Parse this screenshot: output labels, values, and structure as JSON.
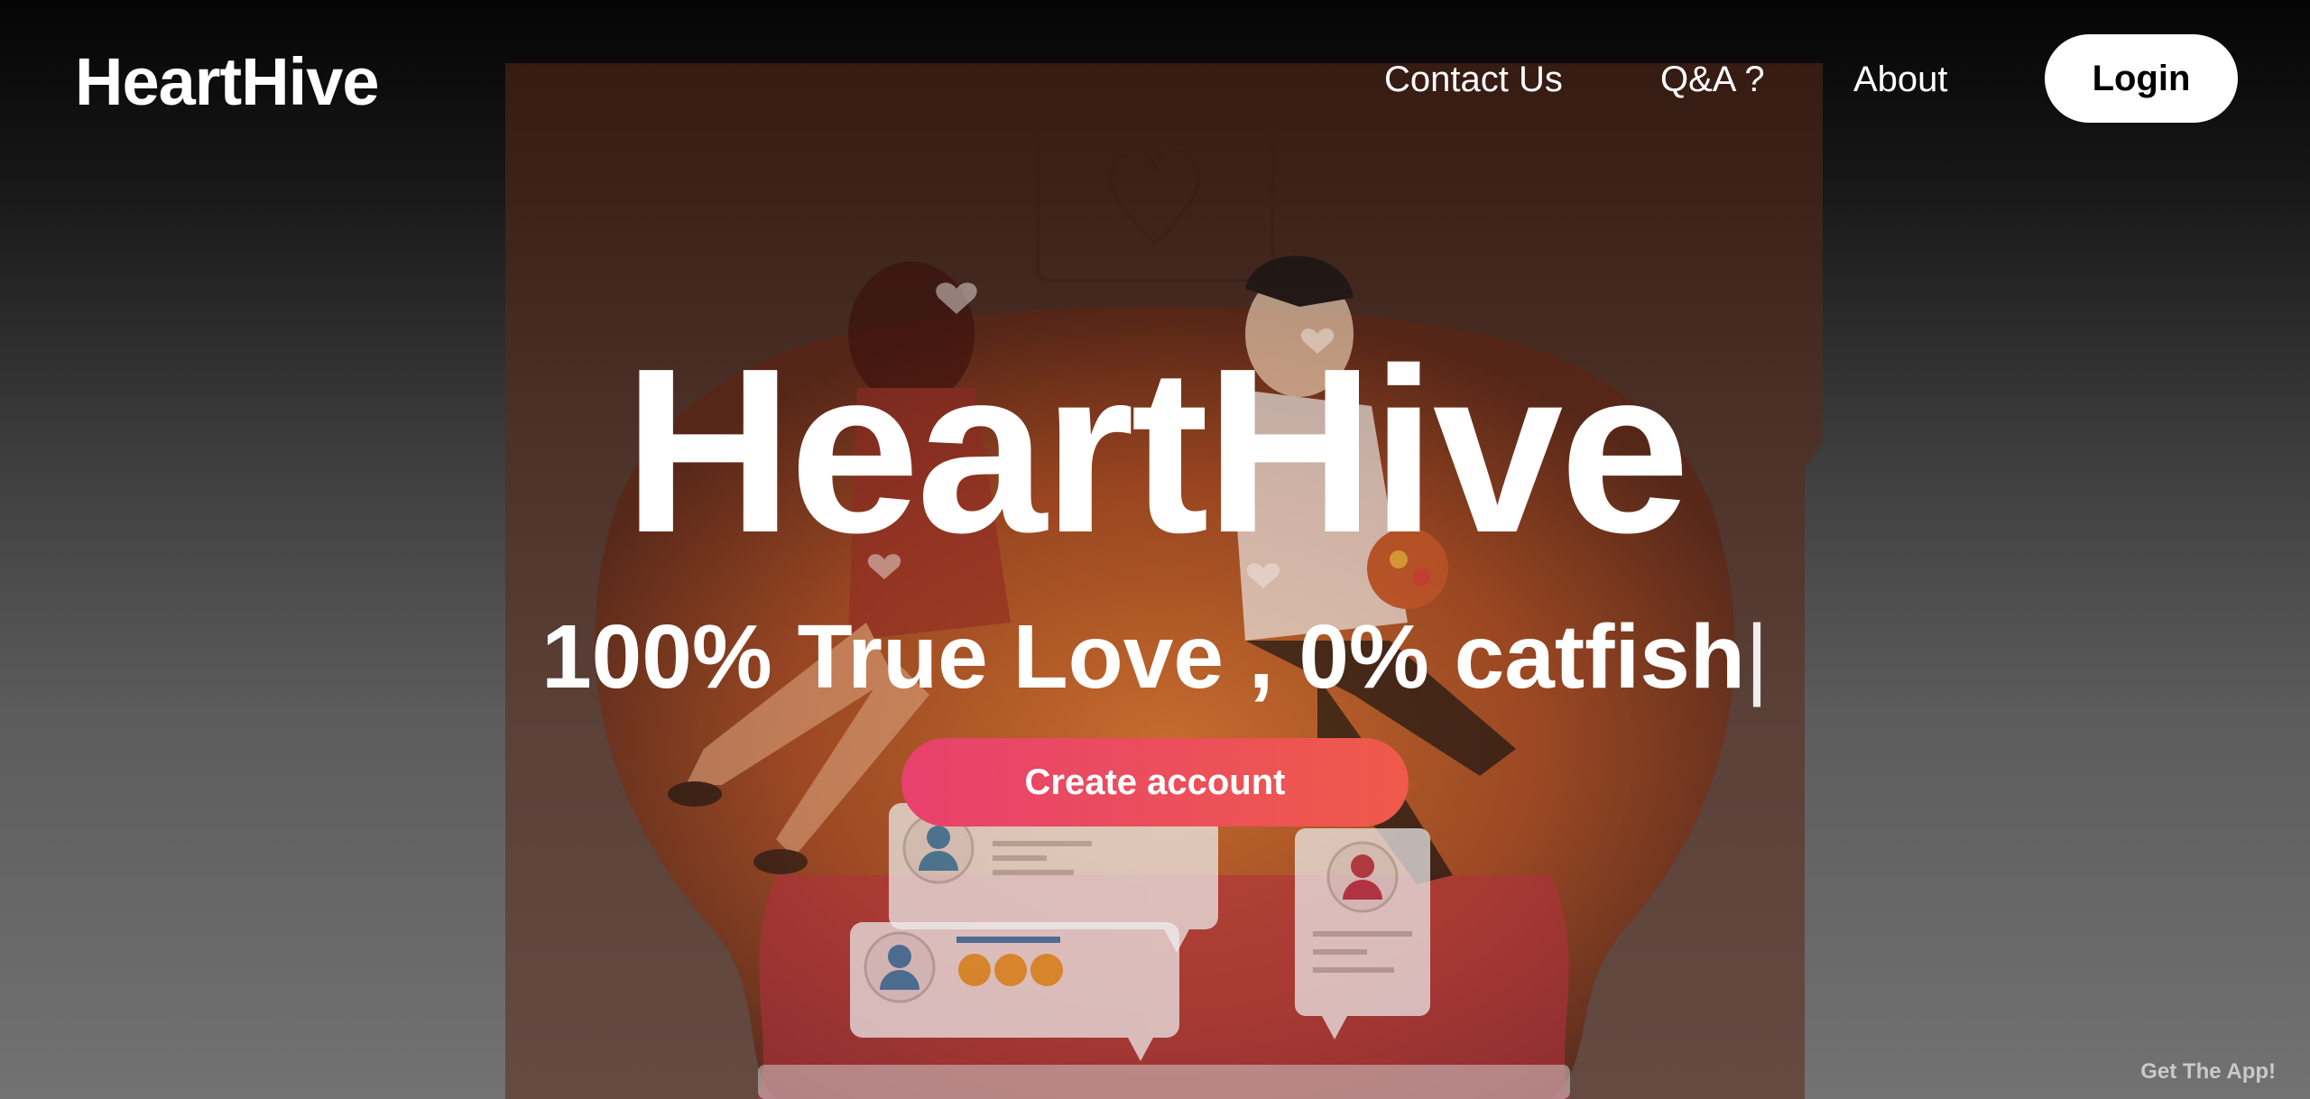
{
  "header": {
    "brand": "HeartHive",
    "nav_items": [
      {
        "label": "Contact Us"
      },
      {
        "label": "Q&A ?"
      },
      {
        "label": "About"
      }
    ],
    "login_label": "Login"
  },
  "hero": {
    "title": "HeartHive",
    "tagline": "100% True Love , 0% catfish",
    "cursor": "|",
    "cta_label": "Create account"
  },
  "footer": {
    "get_app_label": "Get The App!"
  },
  "colors": {
    "cta_gradient_start": "#e8416e",
    "cta_gradient_end": "#ef5a4a",
    "login_bg": "#ffffff",
    "illustration_accent": "#e66a2b"
  },
  "icons": [
    "dating-illustration",
    "heart-icon",
    "user-avatar-icon",
    "heart-eyes-emoji"
  ]
}
